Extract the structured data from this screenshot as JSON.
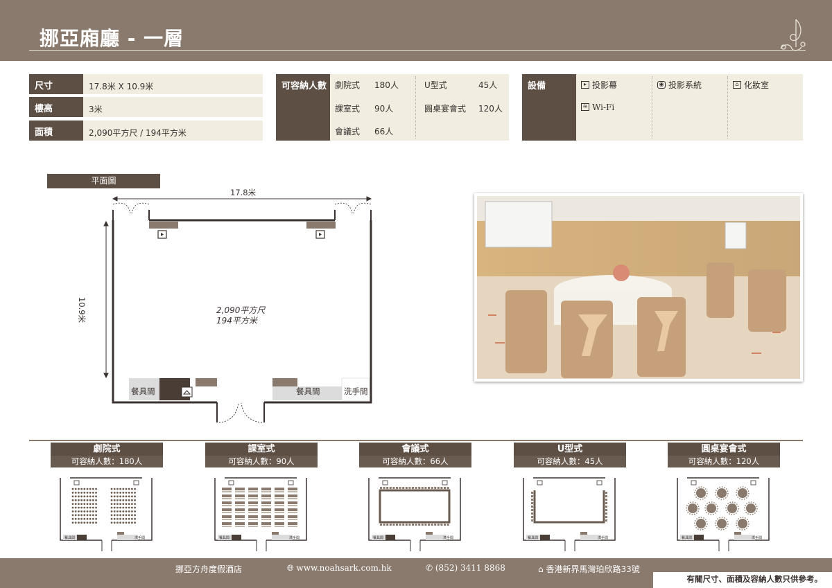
{
  "header": {
    "title": "挪亞廂廳 - 一層",
    "band_color": "#8a7a6d"
  },
  "specs": [
    {
      "label": "尺寸",
      "value": "17.8米 X 10.9米"
    },
    {
      "label": "樓高",
      "value": "3米"
    },
    {
      "label": "面積",
      "value": "2,090平方尺 / 194平方米"
    }
  ],
  "capacity": {
    "label": "可容納人數",
    "items": [
      {
        "name": "劇院式",
        "count": "180人"
      },
      {
        "name": "課室式",
        "count": "90人"
      },
      {
        "name": "會議式",
        "count": "66人"
      },
      {
        "name": "U型式",
        "count": "45人"
      },
      {
        "name": "圓桌宴會式",
        "count": "120人"
      }
    ]
  },
  "equipment": {
    "label": "設備",
    "items": [
      {
        "name": "投影幕",
        "icon": "projection-screen-icon"
      },
      {
        "name": "投影系統",
        "icon": "projector-icon"
      },
      {
        "name": "化妝室",
        "icon": "hanger-icon"
      },
      {
        "name": "Wi-Fi",
        "icon": "wifi-icon"
      }
    ]
  },
  "floorplan": {
    "label": "平面圖",
    "width_label": "17.8米",
    "height_label": "10.9米",
    "area_sqft": "2,090平方尺",
    "area_sqm": "194平方米",
    "room_labels": [
      "餐具間",
      "餐具間",
      "洗手間"
    ]
  },
  "layouts": [
    {
      "name": "劇院式",
      "capacity": "可容納人數：180人"
    },
    {
      "name": "課室式",
      "capacity": "可容納人數：90人"
    },
    {
      "name": "會議式",
      "capacity": "可容納人數：66人"
    },
    {
      "name": "U型式",
      "capacity": "可容納人數：45人"
    },
    {
      "name": "圓桌宴會式",
      "capacity": "可容納人數：120人"
    }
  ],
  "mini_labels": {
    "pantry": "餐具間",
    "toilet": "洗手間"
  },
  "footer": {
    "hotel": "挪亞方舟度假酒店",
    "website": "www.noahsark.com.hk",
    "phone": "(852) 3411 8868",
    "address": "香港新界馬灣珀欣路33號",
    "disclaimer": "有關尺寸、面積及容納人數只供參考。"
  }
}
